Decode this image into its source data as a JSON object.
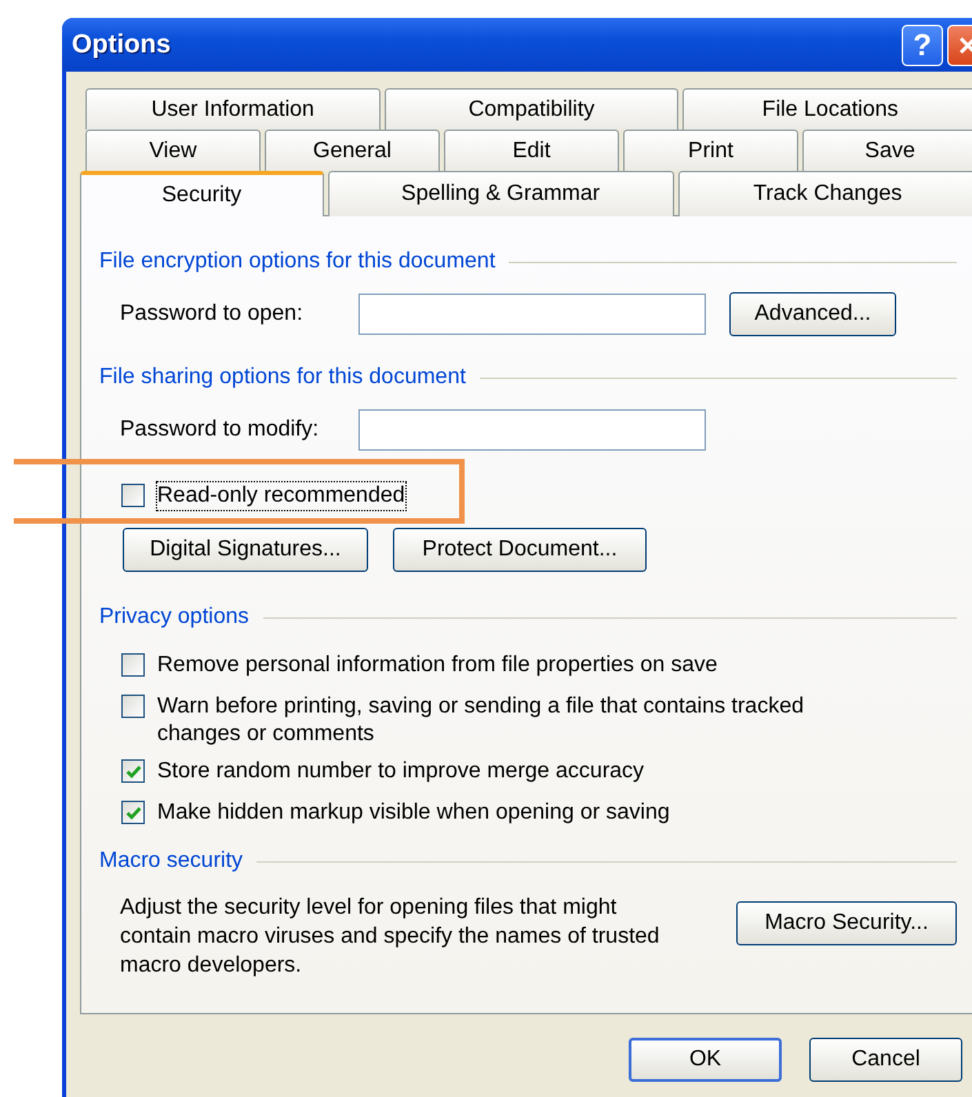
{
  "window": {
    "title": "Options",
    "help": "?"
  },
  "tabs": [
    [
      {
        "label": "User Information",
        "selected": false
      },
      {
        "label": "Compatibility",
        "selected": false
      },
      {
        "label": "File Locations",
        "selected": false
      }
    ],
    [
      {
        "label": "View",
        "selected": false
      },
      {
        "label": "General",
        "selected": false
      },
      {
        "label": "Edit",
        "selected": false
      },
      {
        "label": "Print",
        "selected": false
      },
      {
        "label": "Save",
        "selected": false
      }
    ],
    [
      {
        "label": "Security",
        "selected": true
      },
      {
        "label": "Spelling & Grammar",
        "selected": false
      },
      {
        "label": "Track Changes",
        "selected": false
      }
    ]
  ],
  "sections": [
    {
      "title": "File encryption options for this document",
      "rows": [
        {
          "kind": "field",
          "label": "Password to open:",
          "button": "Advanced..."
        }
      ]
    },
    {
      "title": "File sharing options for this document",
      "rows": [
        {
          "kind": "field",
          "label": "Password to modify:"
        },
        {
          "kind": "checkbox",
          "label": "Read-only recommended",
          "checked": false,
          "focused": true,
          "highlighted": true
        },
        {
          "kind": "buttons",
          "buttons": [
            "Digital Signatures...",
            "Protect Document..."
          ]
        }
      ]
    },
    {
      "title": "Privacy options",
      "rows": [
        {
          "kind": "checkbox",
          "label": "Remove personal information from file properties on save",
          "checked": false,
          "focused": false,
          "highlighted": false
        },
        {
          "kind": "checkbox",
          "label": "Warn before printing, saving or sending a file that contains tracked changes or comments",
          "checked": false,
          "focused": false,
          "highlighted": false
        },
        {
          "kind": "checkbox",
          "label": "Store random number to improve merge accuracy",
          "checked": true,
          "focused": false,
          "highlighted": false
        },
        {
          "kind": "checkbox",
          "label": "Make hidden markup visible when opening or saving",
          "checked": true,
          "focused": false,
          "highlighted": false
        }
      ]
    },
    {
      "title": "Macro security",
      "rows": [
        {
          "kind": "note",
          "text": "Adjust the security level for opening files that might contain macro viruses and specify the names of trusted macro developers.",
          "button": "Macro Security..."
        }
      ]
    }
  ],
  "footer": [
    {
      "label": "OK",
      "default": true
    },
    {
      "label": "Cancel",
      "default": false
    }
  ]
}
